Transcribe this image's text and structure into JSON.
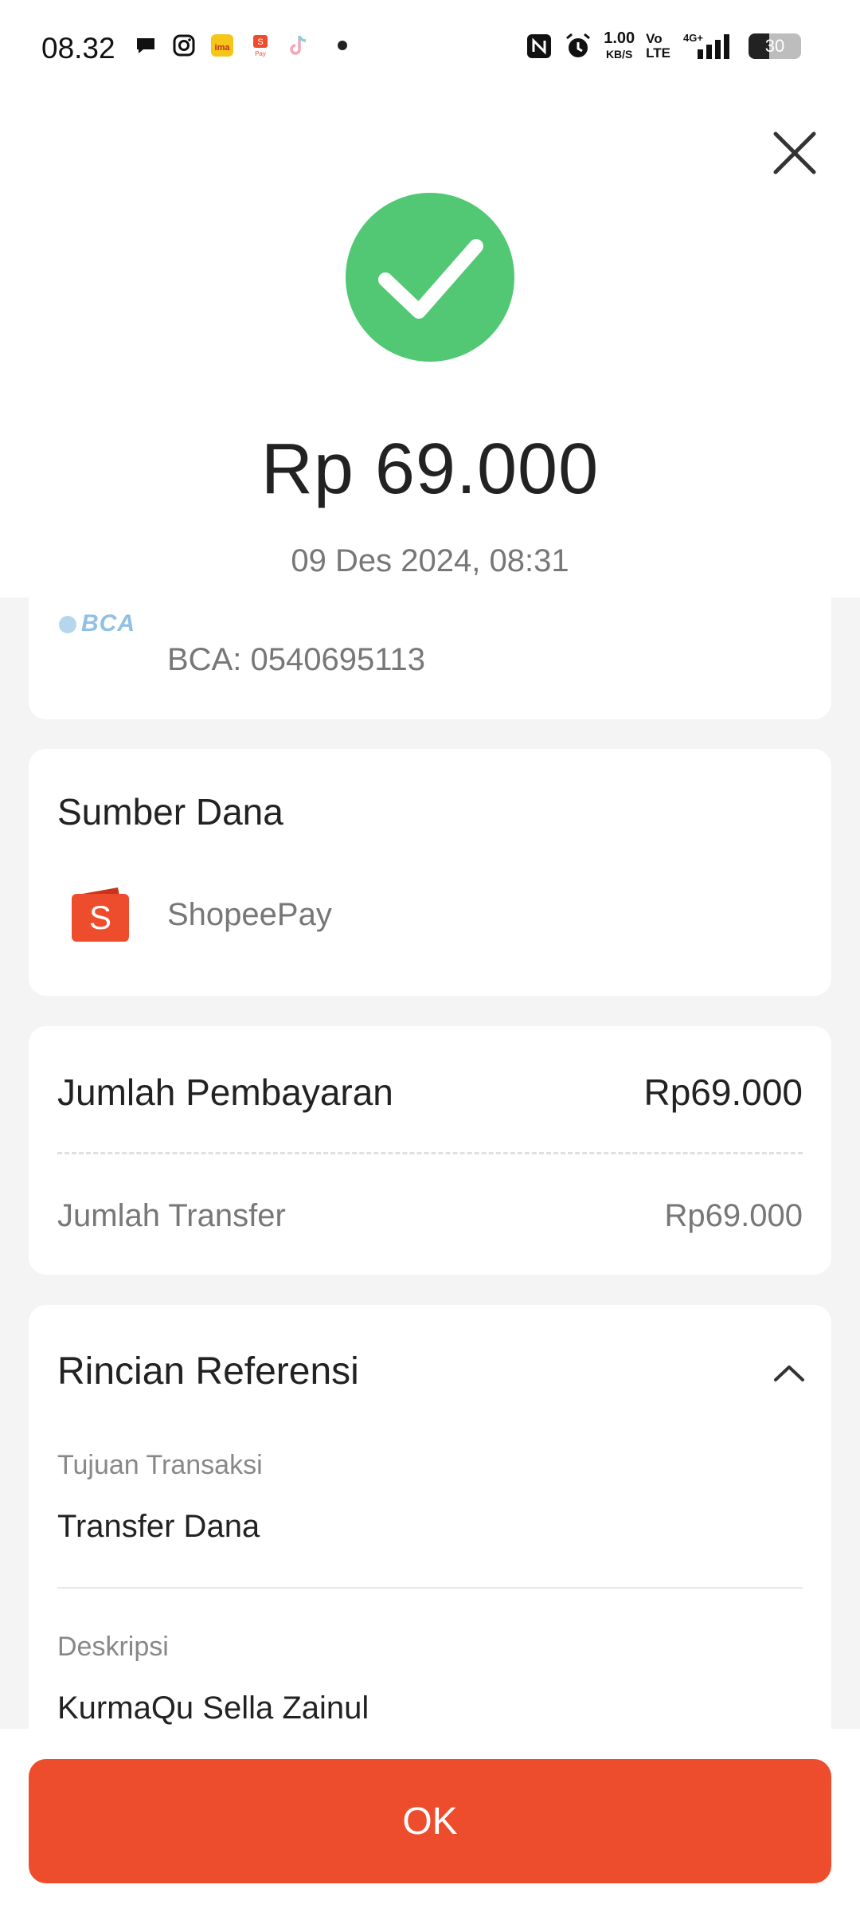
{
  "status_bar": {
    "time": "08.32",
    "net_speed": "1.00",
    "net_speed_unit": "KB/S",
    "volte_line1": "Vo",
    "volte_line2": "LTE",
    "network": "4G+",
    "battery": "30",
    "icons": [
      "message-icon",
      "instagram-icon",
      "ima-app-icon",
      "shopeepay-icon",
      "tiktok-icon",
      "nfc-icon",
      "alarm-icon",
      "signal-icon",
      "battery-icon"
    ]
  },
  "header": {
    "amount": "Rp 69.000",
    "datetime": "09 Des 2024, 08:31",
    "success_color": "#52c875"
  },
  "recipient": {
    "bank_logo_text": "BCA",
    "account": "BCA: 0540695113"
  },
  "source": {
    "title": "Sumber Dana",
    "name": "ShopeePay",
    "icon": "shopeepay-wallet-icon"
  },
  "payment": {
    "total_label": "Jumlah Pembayaran",
    "total_value": "Rp69.000",
    "transfer_label": "Jumlah Transfer",
    "transfer_value": "Rp69.000"
  },
  "reference": {
    "title": "Rincian Referensi",
    "purpose_label": "Tujuan Transaksi",
    "purpose_value": "Transfer Dana",
    "description_label": "Deskripsi",
    "description_value": "KurmaQu Sella Zainul"
  },
  "footer": {
    "ok_label": "OK",
    "accent_color": "#ee4d2d"
  }
}
